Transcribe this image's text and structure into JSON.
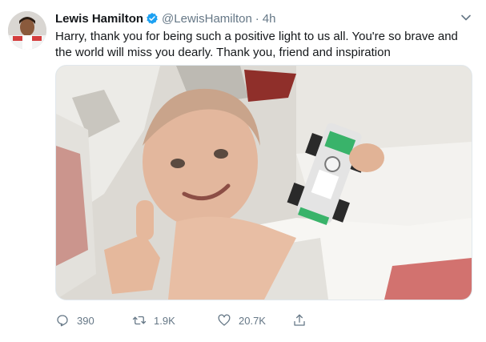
{
  "tweet": {
    "author_name": "Lewis Hamilton",
    "handle": "@LewisHamilton",
    "separator": "·",
    "time": "4h",
    "text": "Harry, thank you for being such a positive light to us all. You're so brave and the world will miss you dearly. Thank you, friend and inspiration",
    "media_alt": "photo-boy-holding-toy-race-car",
    "verified_color": "#1da1f2"
  },
  "actions": {
    "reply_count": "390",
    "retweet_count": "1.9K",
    "like_count": "20.7K"
  },
  "icons": {
    "verified": "verified-badge-icon",
    "caret": "chevron-down-icon",
    "reply": "reply-icon",
    "retweet": "retweet-icon",
    "like": "heart-icon",
    "share": "share-icon"
  },
  "colors": {
    "text": "#14171a",
    "secondary": "#657786",
    "border": "#e1e8ed"
  }
}
